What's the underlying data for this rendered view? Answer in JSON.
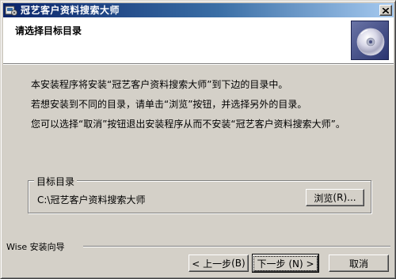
{
  "window": {
    "title": "冠艺客户资料搜索大师",
    "close_symbol": "×"
  },
  "header": {
    "title": "请选择目标目录"
  },
  "messages": {
    "line1": "本安装程序将安装“冠艺客户资料搜索大师”到下边的目录中。",
    "line2": "若想安装到不同的目录，请单击“浏览”按钮，并选择另外的目录。",
    "line3": "您可以选择“取消”按钮退出安装程序从而不安装“冠艺客户资料搜索大师”。"
  },
  "destination": {
    "group_label": "目标目录",
    "path": "C:\\冠艺客户资料搜索大师",
    "browse_label": "浏览",
    "browse_key": "(R)...",
    "browse_key_letter": "R"
  },
  "footer": {
    "brand_label": "Wise 安装向导",
    "back_label": "< 上一步",
    "back_key": "(B)",
    "next_label": "下一步",
    "next_key": "(N) >",
    "cancel_label": "取消"
  },
  "colors": {
    "title_start": "#0a246a",
    "title_end": "#a6caf0",
    "face": "#d4d0c8"
  },
  "icons": {
    "app": "setup-app-icon",
    "header": "cd-disc-icon",
    "close": "close-icon"
  }
}
